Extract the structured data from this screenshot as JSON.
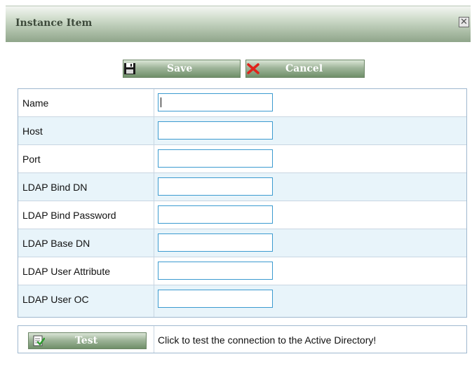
{
  "dialog": {
    "title": "Instance Item",
    "close_symbol": "✕"
  },
  "toolbar": {
    "save_label": "Save",
    "save_icon": "floppy-disk-icon",
    "cancel_label": "Cancel",
    "cancel_icon": "red-x-icon"
  },
  "form": {
    "fields": [
      {
        "label": "Name",
        "value": "",
        "focused": true
      },
      {
        "label": "Host",
        "value": ""
      },
      {
        "label": "Port",
        "value": ""
      },
      {
        "label": "LDAP Bind DN",
        "value": ""
      },
      {
        "label": "LDAP Bind Password",
        "value": ""
      },
      {
        "label": "LDAP Base DN",
        "value": ""
      },
      {
        "label": "LDAP User Attribute",
        "value": ""
      },
      {
        "label": "LDAP User OC",
        "value": ""
      }
    ]
  },
  "test": {
    "button_label": "Test",
    "button_icon": "test-connection-icon",
    "hint": "Click to test the connection to the Active Directory!"
  },
  "colors": {
    "titlebar_green": "#8fa58a",
    "button_green": "#7f9c79",
    "alt_row": "#e8f4fa",
    "input_border": "#3c9bd0",
    "cancel_red": "#e0231b"
  }
}
